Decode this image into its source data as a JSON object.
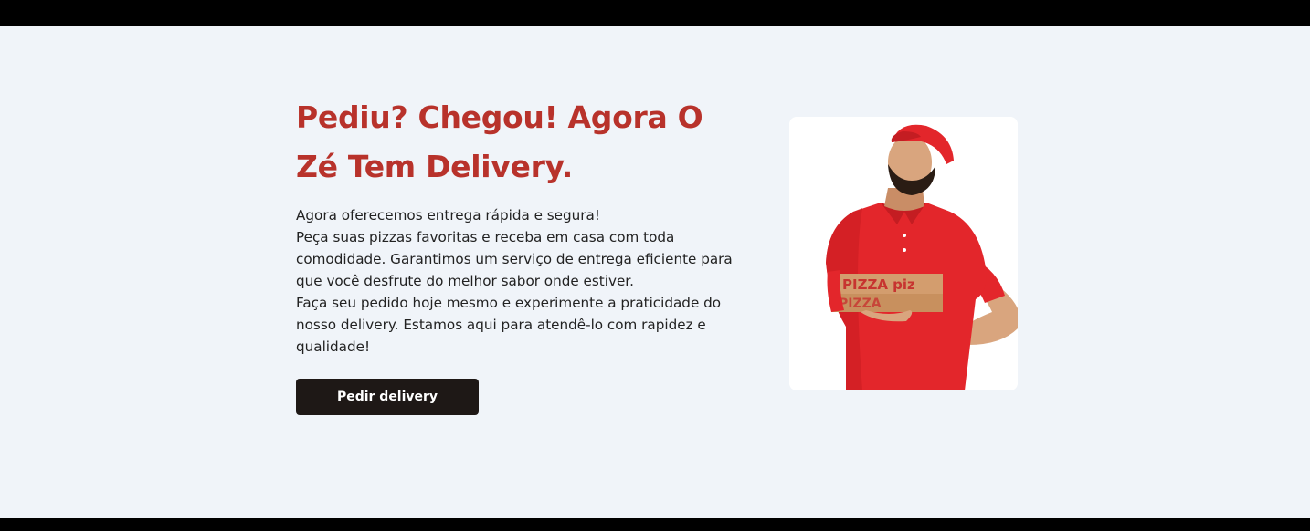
{
  "hero": {
    "title": "Pediu? Chegou! Agora O Zé Tem Delivery.",
    "paragraph_lines": [
      "Agora oferecemos entrega rápida e segura!",
      "Peça suas pizzas favoritas e receba em casa com toda comodidade. Garantimos um serviço de entrega eficiente para que você desfrute do melhor sabor onde estiver.",
      "Faça seu pedido hoje mesmo e experimente a praticidade do nosso delivery. Estamos aqui para atendê-lo com rapidez e qualidade!"
    ],
    "cta_label": "Pedir delivery",
    "image": {
      "icon": "delivery-man-photo",
      "box_text": "PIZZA piz"
    }
  },
  "colors": {
    "background": "#f0f4f9",
    "title": "#b8322b",
    "button": "#1e1816",
    "shirt": "#e3262b"
  }
}
